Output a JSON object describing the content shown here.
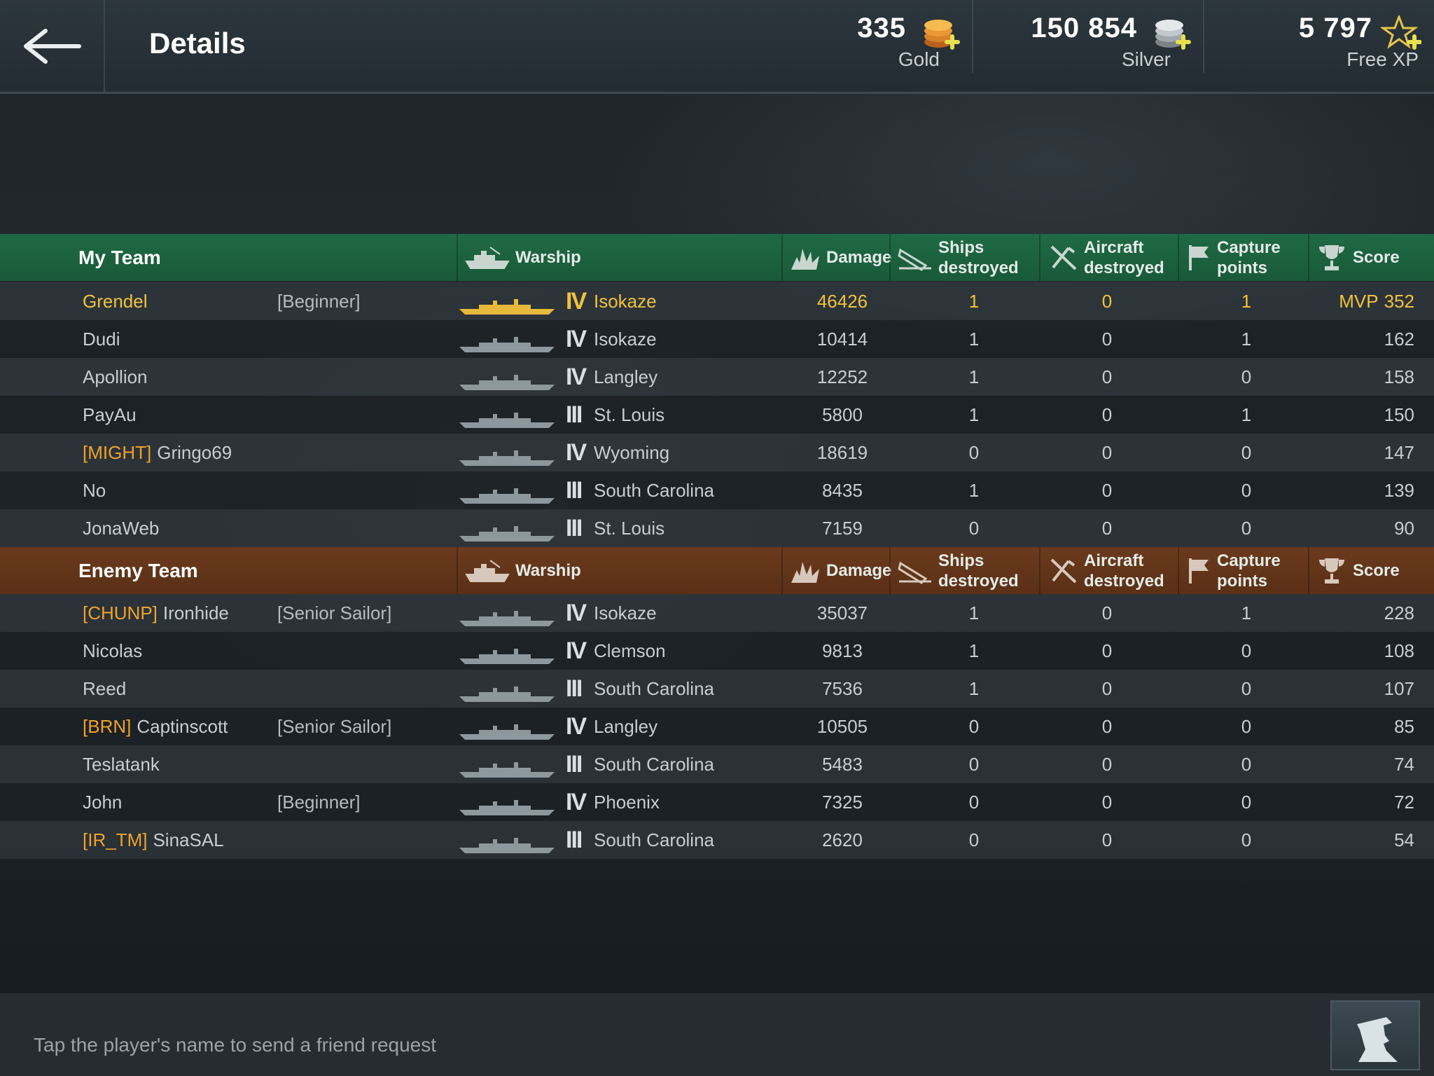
{
  "header": {
    "title": "Details",
    "currencies": [
      {
        "amount": "335",
        "label": "Gold",
        "icon": "gold-coins-icon"
      },
      {
        "amount": "150 854",
        "label": "Silver",
        "icon": "silver-coins-icon"
      },
      {
        "amount": "5 797",
        "label": "Free XP",
        "icon": "free-xp-star-icon"
      }
    ]
  },
  "columns": {
    "warship": "Warship",
    "damage": "Damage",
    "ships_destroyed_1": "Ships",
    "ships_destroyed_2": "destroyed",
    "aircraft_destroyed_1": "Aircraft",
    "aircraft_destroyed_2": "destroyed",
    "capture_points_1": "Capture",
    "capture_points_2": "points",
    "score": "Score"
  },
  "my_team": {
    "title": "My Team",
    "players": [
      {
        "clan": "",
        "name": "Grendel",
        "rank": "[Beginner]",
        "tier": "IV",
        "warship": "Isokaze",
        "damage": "46426",
        "ships": "1",
        "aircraft": "0",
        "capture": "1",
        "mvp": "MVP",
        "score": "352"
      },
      {
        "clan": "",
        "name": "Dudi",
        "rank": "",
        "tier": "IV",
        "warship": "Isokaze",
        "damage": "10414",
        "ships": "1",
        "aircraft": "0",
        "capture": "1",
        "mvp": "",
        "score": "162"
      },
      {
        "clan": "",
        "name": "Apollion",
        "rank": "",
        "tier": "IV",
        "warship": "Langley",
        "damage": "12252",
        "ships": "1",
        "aircraft": "0",
        "capture": "0",
        "mvp": "",
        "score": "158"
      },
      {
        "clan": "",
        "name": "PayAu",
        "rank": "",
        "tier": "III",
        "warship": "St. Louis",
        "damage": "5800",
        "ships": "1",
        "aircraft": "0",
        "capture": "1",
        "mvp": "",
        "score": "150"
      },
      {
        "clan": "[MIGHT]",
        "name": "Gringo69",
        "rank": "",
        "tier": "IV",
        "warship": "Wyoming",
        "damage": "18619",
        "ships": "0",
        "aircraft": "0",
        "capture": "0",
        "mvp": "",
        "score": "147"
      },
      {
        "clan": "",
        "name": "No",
        "rank": "",
        "tier": "III",
        "warship": "South Carolina",
        "damage": "8435",
        "ships": "1",
        "aircraft": "0",
        "capture": "0",
        "mvp": "",
        "score": "139"
      },
      {
        "clan": "",
        "name": "JonaWeb",
        "rank": "",
        "tier": "III",
        "warship": "St. Louis",
        "damage": "7159",
        "ships": "0",
        "aircraft": "0",
        "capture": "0",
        "mvp": "",
        "score": "90"
      }
    ]
  },
  "enemy_team": {
    "title": "Enemy Team",
    "players": [
      {
        "clan": "[CHUNP]",
        "name": "Ironhide",
        "rank": "[Senior Sailor]",
        "tier": "IV",
        "warship": "Isokaze",
        "damage": "35037",
        "ships": "1",
        "aircraft": "0",
        "capture": "1",
        "mvp": "",
        "score": "228"
      },
      {
        "clan": "",
        "name": "Nicolas",
        "rank": "",
        "tier": "IV",
        "warship": "Clemson",
        "damage": "9813",
        "ships": "1",
        "aircraft": "0",
        "capture": "0",
        "mvp": "",
        "score": "108"
      },
      {
        "clan": "",
        "name": "Reed",
        "rank": "",
        "tier": "III",
        "warship": "South Carolina",
        "damage": "7536",
        "ships": "1",
        "aircraft": "0",
        "capture": "0",
        "mvp": "",
        "score": "107"
      },
      {
        "clan": "[BRN]",
        "name": "Captinscott",
        "rank": "[Senior Sailor]",
        "tier": "IV",
        "warship": "Langley",
        "damage": "10505",
        "ships": "0",
        "aircraft": "0",
        "capture": "0",
        "mvp": "",
        "score": "85"
      },
      {
        "clan": "",
        "name": "Teslatank",
        "rank": "",
        "tier": "III",
        "warship": "South Carolina",
        "damage": "5483",
        "ships": "0",
        "aircraft": "0",
        "capture": "0",
        "mvp": "",
        "score": "74"
      },
      {
        "clan": "",
        "name": "John",
        "rank": "[Beginner]",
        "tier": "IV",
        "warship": "Phoenix",
        "damage": "7325",
        "ships": "0",
        "aircraft": "0",
        "capture": "0",
        "mvp": "",
        "score": "72"
      },
      {
        "clan": "[IR_TM]",
        "name": "SinaSAL",
        "rank": "",
        "tier": "III",
        "warship": "South Carolina",
        "damage": "2620",
        "ships": "0",
        "aircraft": "0",
        "capture": "0",
        "mvp": "",
        "score": "54"
      }
    ]
  },
  "footer": {
    "hint": "Tap the player's name to send a friend request",
    "portrait_button_icon": "captain-portrait-icon"
  },
  "colors": {
    "my_team_header": "#1f6a44",
    "enemy_team_header": "#6b3a1d",
    "clan_tag": "#f0a22b",
    "mvp": "#ef7d24",
    "highlight_row": "#f2c23a"
  }
}
